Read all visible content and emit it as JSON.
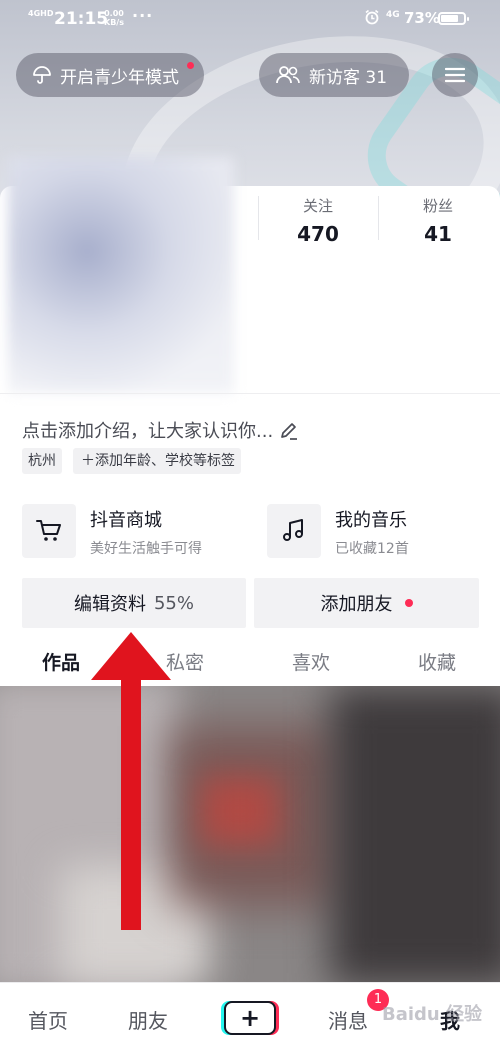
{
  "status_bar": {
    "network": "4GHD",
    "time": "21:15",
    "speed_value": "0.00",
    "speed_unit": "KB/s",
    "dots": "···",
    "cellular": "4G",
    "battery": "73%"
  },
  "header": {
    "teen_mode_label": "开启青少年模式",
    "visitors_label": "新访客 31"
  },
  "stats": {
    "following_label": "关注",
    "following_value": "470",
    "fans_label": "粉丝",
    "fans_value": "41"
  },
  "profile": {
    "bio_placeholder": "点击添加介绍，让大家认识你...",
    "tags": [
      "杭州",
      "添加年龄、学校等标签"
    ]
  },
  "features": {
    "shop_title": "抖音商城",
    "shop_subtitle": "美好生活触手可得",
    "music_title": "我的音乐",
    "music_subtitle": "已收藏12首"
  },
  "actions": {
    "edit_label": "编辑资料",
    "edit_percent": "55%",
    "add_friend_label": "添加朋友"
  },
  "tabs": {
    "works": "作品",
    "private": "私密",
    "likes": "喜欢",
    "favorites": "收藏"
  },
  "bottom_nav": {
    "home": "首页",
    "friends": "朋友",
    "plus": "+",
    "messages": "消息",
    "messages_badge": "1",
    "me": "我"
  },
  "watermark": "Baidu 经验",
  "colors": {
    "accent_red": "#fe2c55",
    "arrow_red": "#e0141e",
    "text_primary": "#161823",
    "button_bg": "#f2f2f4"
  }
}
